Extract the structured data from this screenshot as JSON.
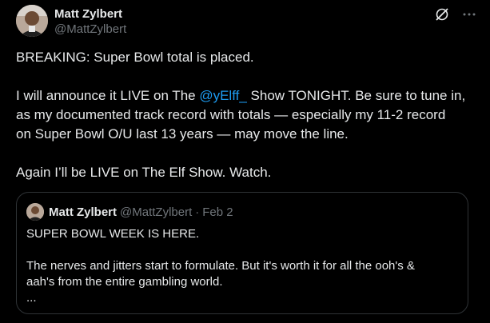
{
  "author": {
    "display_name": "Matt Zylbert",
    "handle": "@MattZylbert"
  },
  "icons": {
    "avatar": "profile-photo",
    "grok": "grok-icon",
    "more": "more-horizontal-icon"
  },
  "tweet": {
    "line1": "BREAKING: Super Bowl total is placed.",
    "para2_before_mention": "I will announce it LIVE on The ",
    "mention": "@yElff_",
    "para2_after_mention": " Show TONIGHT. Be sure to tune in,",
    "para2_line2": "as my documented track record with totals — especially my 11-2 record",
    "para2_line3": "on Super Bowl O/U last 13 years — may move the line.",
    "line_last": "Again I’ll be LIVE on The Elf Show. Watch."
  },
  "quote": {
    "display_name": "Matt Zylbert",
    "handle": "@MattZylbert",
    "separator": "·",
    "date": "Feb 2",
    "line1": "SUPER BOWL WEEK IS HERE.",
    "line2": "The nerves and jitters start to formulate. But it's worth it for all the ooh's &",
    "line3": "aah's from the entire gambling world.",
    "line4": "..."
  },
  "colors": {
    "background": "#000000",
    "text": "#e7e9ea",
    "muted": "#71767b",
    "link": "#1d9bf0",
    "border": "#2f3336"
  }
}
